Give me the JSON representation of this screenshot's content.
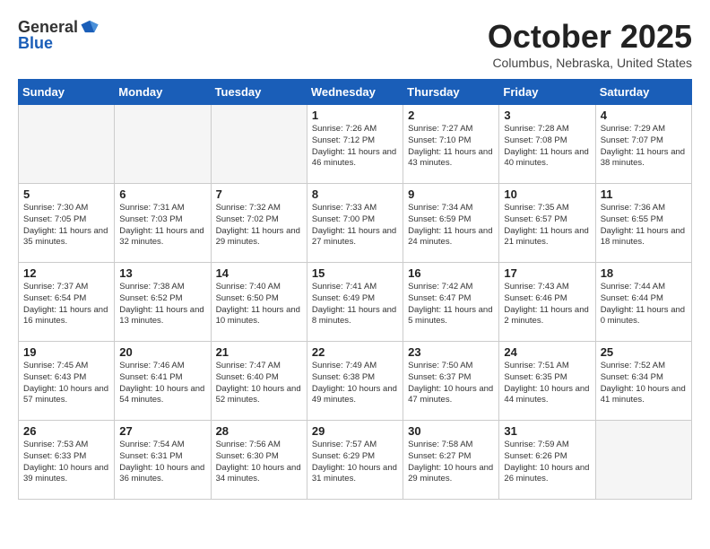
{
  "header": {
    "logo_general": "General",
    "logo_blue": "Blue",
    "month": "October 2025",
    "location": "Columbus, Nebraska, United States"
  },
  "weekdays": [
    "Sunday",
    "Monday",
    "Tuesday",
    "Wednesday",
    "Thursday",
    "Friday",
    "Saturday"
  ],
  "weeks": [
    [
      {
        "day": "",
        "empty": true
      },
      {
        "day": "",
        "empty": true
      },
      {
        "day": "",
        "empty": true
      },
      {
        "day": "1",
        "sunrise": "Sunrise: 7:26 AM",
        "sunset": "Sunset: 7:12 PM",
        "daylight": "Daylight: 11 hours and 46 minutes."
      },
      {
        "day": "2",
        "sunrise": "Sunrise: 7:27 AM",
        "sunset": "Sunset: 7:10 PM",
        "daylight": "Daylight: 11 hours and 43 minutes."
      },
      {
        "day": "3",
        "sunrise": "Sunrise: 7:28 AM",
        "sunset": "Sunset: 7:08 PM",
        "daylight": "Daylight: 11 hours and 40 minutes."
      },
      {
        "day": "4",
        "sunrise": "Sunrise: 7:29 AM",
        "sunset": "Sunset: 7:07 PM",
        "daylight": "Daylight: 11 hours and 38 minutes."
      }
    ],
    [
      {
        "day": "5",
        "sunrise": "Sunrise: 7:30 AM",
        "sunset": "Sunset: 7:05 PM",
        "daylight": "Daylight: 11 hours and 35 minutes."
      },
      {
        "day": "6",
        "sunrise": "Sunrise: 7:31 AM",
        "sunset": "Sunset: 7:03 PM",
        "daylight": "Daylight: 11 hours and 32 minutes."
      },
      {
        "day": "7",
        "sunrise": "Sunrise: 7:32 AM",
        "sunset": "Sunset: 7:02 PM",
        "daylight": "Daylight: 11 hours and 29 minutes."
      },
      {
        "day": "8",
        "sunrise": "Sunrise: 7:33 AM",
        "sunset": "Sunset: 7:00 PM",
        "daylight": "Daylight: 11 hours and 27 minutes."
      },
      {
        "day": "9",
        "sunrise": "Sunrise: 7:34 AM",
        "sunset": "Sunset: 6:59 PM",
        "daylight": "Daylight: 11 hours and 24 minutes."
      },
      {
        "day": "10",
        "sunrise": "Sunrise: 7:35 AM",
        "sunset": "Sunset: 6:57 PM",
        "daylight": "Daylight: 11 hours and 21 minutes."
      },
      {
        "day": "11",
        "sunrise": "Sunrise: 7:36 AM",
        "sunset": "Sunset: 6:55 PM",
        "daylight": "Daylight: 11 hours and 18 minutes."
      }
    ],
    [
      {
        "day": "12",
        "sunrise": "Sunrise: 7:37 AM",
        "sunset": "Sunset: 6:54 PM",
        "daylight": "Daylight: 11 hours and 16 minutes."
      },
      {
        "day": "13",
        "sunrise": "Sunrise: 7:38 AM",
        "sunset": "Sunset: 6:52 PM",
        "daylight": "Daylight: 11 hours and 13 minutes."
      },
      {
        "day": "14",
        "sunrise": "Sunrise: 7:40 AM",
        "sunset": "Sunset: 6:50 PM",
        "daylight": "Daylight: 11 hours and 10 minutes."
      },
      {
        "day": "15",
        "sunrise": "Sunrise: 7:41 AM",
        "sunset": "Sunset: 6:49 PM",
        "daylight": "Daylight: 11 hours and 8 minutes."
      },
      {
        "day": "16",
        "sunrise": "Sunrise: 7:42 AM",
        "sunset": "Sunset: 6:47 PM",
        "daylight": "Daylight: 11 hours and 5 minutes."
      },
      {
        "day": "17",
        "sunrise": "Sunrise: 7:43 AM",
        "sunset": "Sunset: 6:46 PM",
        "daylight": "Daylight: 11 hours and 2 minutes."
      },
      {
        "day": "18",
        "sunrise": "Sunrise: 7:44 AM",
        "sunset": "Sunset: 6:44 PM",
        "daylight": "Daylight: 11 hours and 0 minutes."
      }
    ],
    [
      {
        "day": "19",
        "sunrise": "Sunrise: 7:45 AM",
        "sunset": "Sunset: 6:43 PM",
        "daylight": "Daylight: 10 hours and 57 minutes."
      },
      {
        "day": "20",
        "sunrise": "Sunrise: 7:46 AM",
        "sunset": "Sunset: 6:41 PM",
        "daylight": "Daylight: 10 hours and 54 minutes."
      },
      {
        "day": "21",
        "sunrise": "Sunrise: 7:47 AM",
        "sunset": "Sunset: 6:40 PM",
        "daylight": "Daylight: 10 hours and 52 minutes."
      },
      {
        "day": "22",
        "sunrise": "Sunrise: 7:49 AM",
        "sunset": "Sunset: 6:38 PM",
        "daylight": "Daylight: 10 hours and 49 minutes."
      },
      {
        "day": "23",
        "sunrise": "Sunrise: 7:50 AM",
        "sunset": "Sunset: 6:37 PM",
        "daylight": "Daylight: 10 hours and 47 minutes."
      },
      {
        "day": "24",
        "sunrise": "Sunrise: 7:51 AM",
        "sunset": "Sunset: 6:35 PM",
        "daylight": "Daylight: 10 hours and 44 minutes."
      },
      {
        "day": "25",
        "sunrise": "Sunrise: 7:52 AM",
        "sunset": "Sunset: 6:34 PM",
        "daylight": "Daylight: 10 hours and 41 minutes."
      }
    ],
    [
      {
        "day": "26",
        "sunrise": "Sunrise: 7:53 AM",
        "sunset": "Sunset: 6:33 PM",
        "daylight": "Daylight: 10 hours and 39 minutes."
      },
      {
        "day": "27",
        "sunrise": "Sunrise: 7:54 AM",
        "sunset": "Sunset: 6:31 PM",
        "daylight": "Daylight: 10 hours and 36 minutes."
      },
      {
        "day": "28",
        "sunrise": "Sunrise: 7:56 AM",
        "sunset": "Sunset: 6:30 PM",
        "daylight": "Daylight: 10 hours and 34 minutes."
      },
      {
        "day": "29",
        "sunrise": "Sunrise: 7:57 AM",
        "sunset": "Sunset: 6:29 PM",
        "daylight": "Daylight: 10 hours and 31 minutes."
      },
      {
        "day": "30",
        "sunrise": "Sunrise: 7:58 AM",
        "sunset": "Sunset: 6:27 PM",
        "daylight": "Daylight: 10 hours and 29 minutes."
      },
      {
        "day": "31",
        "sunrise": "Sunrise: 7:59 AM",
        "sunset": "Sunset: 6:26 PM",
        "daylight": "Daylight: 10 hours and 26 minutes."
      },
      {
        "day": "",
        "empty": true
      }
    ]
  ]
}
